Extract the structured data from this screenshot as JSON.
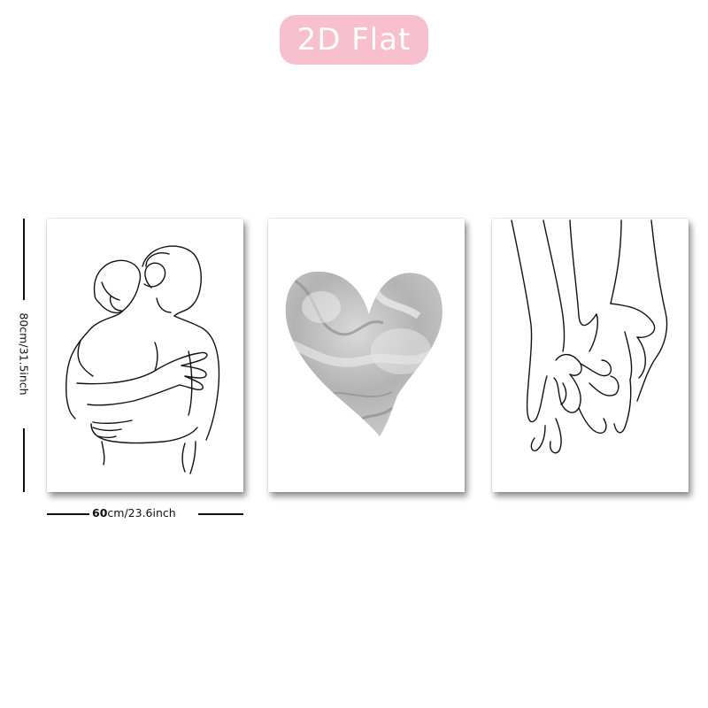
{
  "badge": {
    "label": "2D Flat",
    "color": "#f8bfcf"
  },
  "dimensions": {
    "width_value": "60",
    "width_suffix": "cm/23.6inch",
    "height_label": "80cm/31.5inch"
  },
  "panels": [
    {
      "subject": "line art of an embracing couple",
      "icon": "embrace-line-art-icon"
    },
    {
      "subject": "grey marble watercolor heart",
      "icon": "marble-heart-icon",
      "heart_color": "#a9a9a9"
    },
    {
      "subject": "line art of two hands holding",
      "icon": "holding-hands-line-art-icon"
    }
  ]
}
